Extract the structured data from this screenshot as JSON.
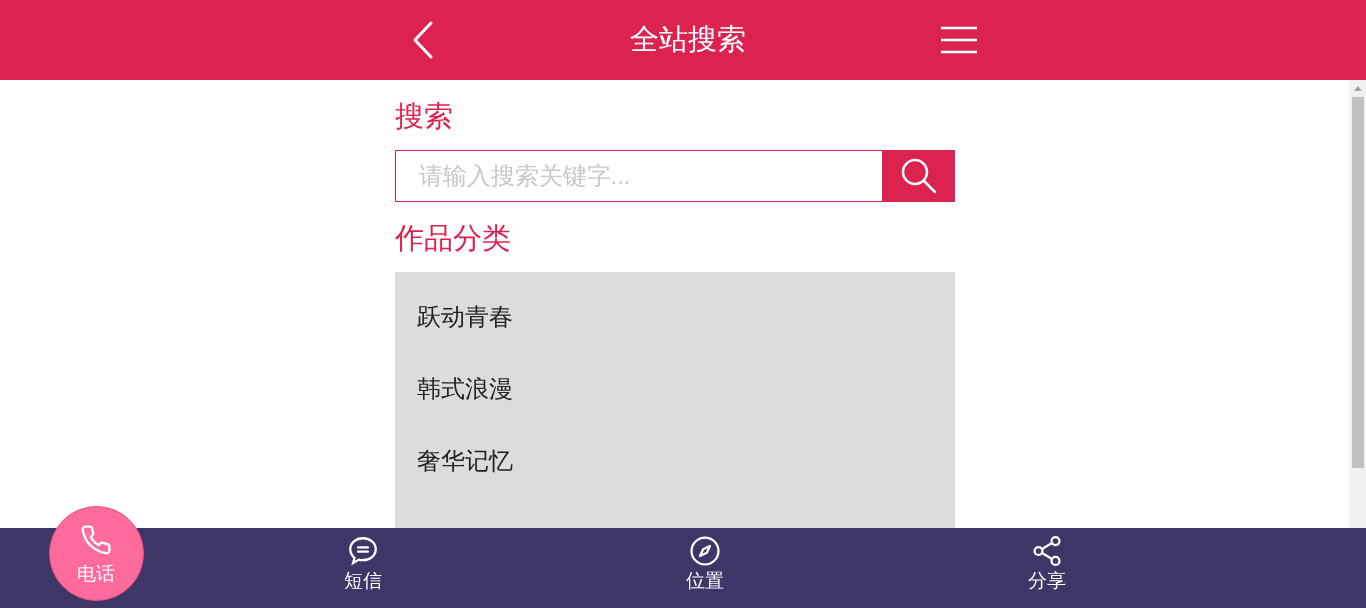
{
  "header": {
    "title": "全站搜索"
  },
  "search": {
    "heading": "搜索",
    "placeholder": "请输入搜索关键字..."
  },
  "categories": {
    "heading": "作品分类",
    "items": [
      {
        "label": "跃动青春"
      },
      {
        "label": "韩式浪漫"
      },
      {
        "label": "奢华记忆"
      }
    ]
  },
  "footer": [
    {
      "kind": "call",
      "label": "电话"
    },
    {
      "kind": "tab",
      "label": "短信"
    },
    {
      "kind": "tab",
      "label": "位置"
    },
    {
      "kind": "tab",
      "label": "分享"
    }
  ]
}
